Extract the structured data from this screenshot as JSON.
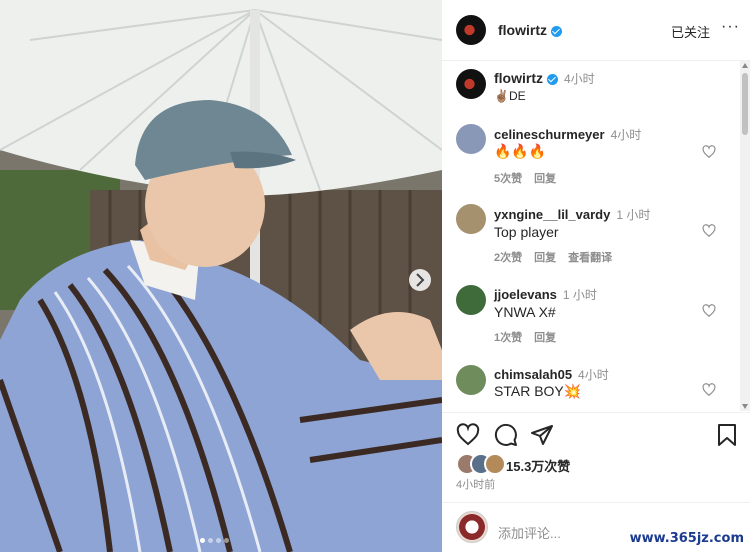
{
  "post": {
    "username": "flowirtz",
    "follow_label": "已关注",
    "more_label": "···",
    "caption": "✌🏽DE",
    "caption_time": "4小时",
    "likes": "15.3万次赞",
    "time_ago": "4小时前",
    "add_comment_placeholder": "添加评论..."
  },
  "comments": [
    {
      "user": "celineschurmeyer",
      "time": "4小时",
      "text": "🔥🔥🔥",
      "likes": "5次赞",
      "reply": "回复",
      "translate": ""
    },
    {
      "user": "yxngine__lil_vardy",
      "time": "1 小时",
      "text": "Top player",
      "likes": "2次赞",
      "reply": "回复",
      "translate": "查看翻译"
    },
    {
      "user": "jjoelevans",
      "time": "1 小时",
      "text": "YNWA X#",
      "likes": "1次赞",
      "reply": "回复",
      "translate": ""
    },
    {
      "user": "chimsalah05",
      "time": "4小时",
      "text": "STAR BOY💥",
      "likes": "",
      "reply": "",
      "translate": ""
    }
  ],
  "watermark": "www.365jz.com",
  "colors": {
    "verified": "#1f9bf0",
    "text": "#262626",
    "secondary": "#8e8e8e"
  }
}
